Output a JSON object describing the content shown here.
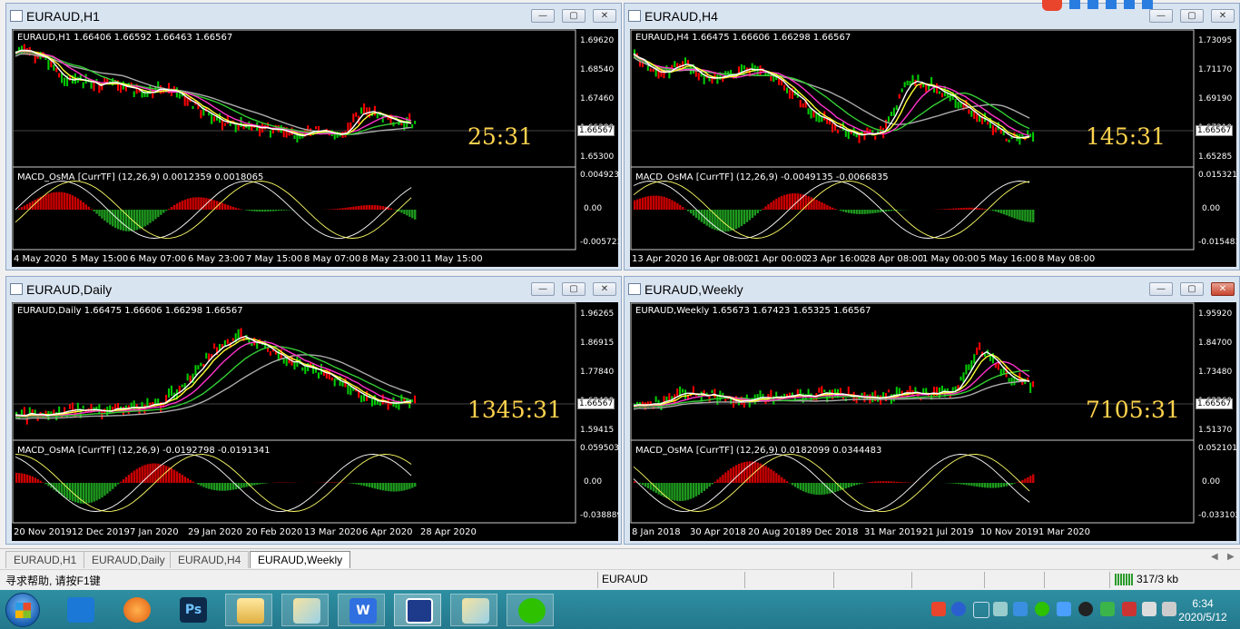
{
  "windows": [
    {
      "id": "h1",
      "title": "EURAUD,H1",
      "symbol_line": "EURAUD,H1  1.66406 1.66592 1.66463 1.66567",
      "macd_line": "MACD_OsMA [CurrTF] (12,26,9) 0.0012359 0.0018065",
      "timer": "25:31",
      "price_labels": [
        "1.69620",
        "1.68540",
        "1.67460",
        "1.66380",
        "1.65300"
      ],
      "current_price": "1.66567",
      "macd_labels": [
        "0.0049231",
        "0.00",
        "-0.005723"
      ],
      "dates": [
        "4 May 2020",
        "5 May 15:00",
        "6 May 07:00",
        "6 May 23:00",
        "7 May 15:00",
        "8 May 07:00",
        "8 May 23:00",
        "11 May 15:00"
      ],
      "active": false
    },
    {
      "id": "h4",
      "title": "EURAUD,H4",
      "symbol_line": "EURAUD,H4  1.66475 1.66606 1.66298 1.66567",
      "macd_line": "MACD_OsMA [CurrTF] (12,26,9) -0.0049135 -0.0066835",
      "timer": "145:31",
      "price_labels": [
        "1.73095",
        "1.71170",
        "1.69190",
        "1.67210",
        "1.65285"
      ],
      "current_price": "1.66567",
      "macd_labels": [
        "0.0153215",
        "0.00",
        "-0.015483"
      ],
      "dates": [
        "13 Apr 2020",
        "16 Apr 08:00",
        "21 Apr 00:00",
        "23 Apr 16:00",
        "28 Apr 08:00",
        "1 May 00:00",
        "5 May 16:00",
        "8 May 08:00"
      ],
      "active": false
    },
    {
      "id": "daily",
      "title": "EURAUD,Daily",
      "symbol_line": "EURAUD,Daily  1.66475 1.66606 1.66298 1.66567",
      "macd_line": "MACD_OsMA [CurrTF] (12,26,9) -0.0192798 -0.0191341",
      "timer": "1345:31",
      "price_labels": [
        "1.96265",
        "1.86915",
        "1.77840",
        "1.68490",
        "1.59415"
      ],
      "current_price": "1.66567",
      "macd_labels": [
        "0.0595038",
        "0.00",
        "-0.038889"
      ],
      "dates": [
        "20 Nov 2019",
        "12 Dec 2019",
        "7 Jan 2020",
        "29 Jan 2020",
        "20 Feb 2020",
        "13 Mar 2020",
        "6 Apr 2020",
        "28 Apr 2020"
      ],
      "active": false
    },
    {
      "id": "weekly",
      "title": "EURAUD,Weekly",
      "symbol_line": "EURAUD,Weekly  1.65673 1.67423 1.65325 1.66567",
      "macd_line": "MACD_OsMA [CurrTF] (12,26,9) 0.0182099 0.0344483",
      "timer": "7105:31",
      "price_labels": [
        "1.95920",
        "1.84700",
        "1.73480",
        "1.62260",
        "1.51370"
      ],
      "current_price": "1.66567",
      "macd_labels": [
        "0.0521015",
        "0.00",
        "-0.033102"
      ],
      "dates": [
        "8 Jan 2018",
        "30 Apr 2018",
        "20 Aug 2018",
        "9 Dec 2018",
        "31 Mar 2019",
        "21 Jul 2019",
        "10 Nov 2019",
        "1 Mar 2020"
      ],
      "active": true
    }
  ],
  "tabs": [
    {
      "label": "EURAUD,H1",
      "active": false
    },
    {
      "label": "EURAUD,Daily",
      "active": false
    },
    {
      "label": "EURAUD,H4",
      "active": false
    },
    {
      "label": "EURAUD,Weekly",
      "active": true
    }
  ],
  "statusbar": {
    "help_text": "寻求帮助, 请按F1键",
    "symbol": "EURAUD",
    "traffic": "317/3 kb"
  },
  "taskbar": {
    "time": "6:34",
    "date": "2020/5/12"
  },
  "colors": {
    "bull": "#00cc00",
    "bear": "#ff0000",
    "ma_white": "#ffffff",
    "ma_yellow": "#ffff33",
    "ma_magenta": "#ff33cc",
    "ma_green": "#33cc33",
    "ma_gray": "#aaaaaa",
    "timer": "#ffd34d"
  }
}
